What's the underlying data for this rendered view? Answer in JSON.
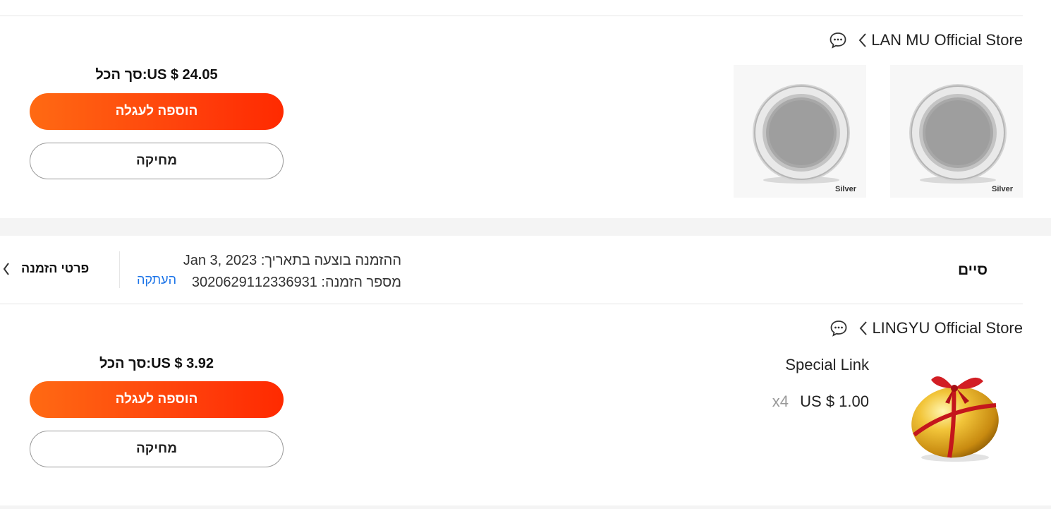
{
  "orders": [
    {
      "store_name": "LAN MU Official Store",
      "total_label": "סך הכל:",
      "total_value": "US $ 24.05",
      "add_to_cart": "הוספה לעגלה",
      "delete": "מחיקה",
      "items": [
        {
          "variant": "Silver"
        },
        {
          "variant": "Silver"
        }
      ]
    },
    {
      "status": "סיים",
      "order_date_label": "ההזמנה בוצעה בתאריך:",
      "order_date": "Jan 3, 2023",
      "order_number_label": "מספר הזמנה:",
      "order_number": "3020629112336931",
      "copy": "העתקה",
      "details": "פרטי הזמנה",
      "store_name": "LINGYU Official Store",
      "product_name": "Special Link",
      "product_price": "US $ 1.00",
      "product_qty": "x4",
      "total_label": "סך הכל:",
      "total_value": "US $ 3.92",
      "add_to_cart": "הוספה לעגלה",
      "delete": "מחיקה"
    }
  ],
  "colors": {
    "accent_start": "#ff6a13",
    "accent_end": "#ff2a00",
    "link": "#1a73e8"
  },
  "icons": [
    "chat-bubble-icon",
    "chevron-left-icon"
  ]
}
